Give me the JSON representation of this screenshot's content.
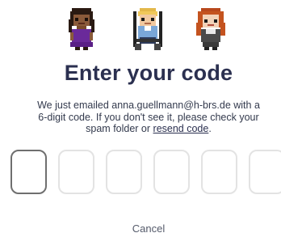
{
  "avatars": [
    {
      "icon": "avatar-woman-purple-dress-icon"
    },
    {
      "icon": "avatar-blonde-man-wheelchair-icon"
    },
    {
      "icon": "avatar-redhead-woman-icon"
    }
  ],
  "title": "Enter your code",
  "description": {
    "line1": "We just emailed anna.guellmann@h-brs.de with a",
    "line2": "6-digit code. If you don't see it, please check your",
    "line3_prefix": "spam folder or ",
    "resend_link": "resend code",
    "line3_suffix": "."
  },
  "code_input": {
    "digits": [
      "",
      "",
      "",
      "",
      "",
      ""
    ],
    "active_index": 0
  },
  "cancel_label": "Cancel",
  "colors": {
    "title": "#2b3050",
    "active_border": "#6f6f6f",
    "inactive_border": "#e3e3e3"
  }
}
